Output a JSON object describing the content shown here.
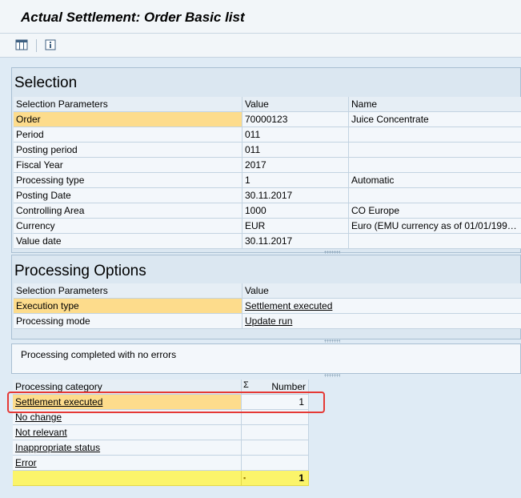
{
  "title": "Actual Settlement: Order Basic list",
  "toolbar": {
    "icons": [
      "column-layout-icon",
      "info-icon"
    ]
  },
  "selection": {
    "heading": "Selection",
    "columns": [
      "Selection Parameters",
      "Value",
      "Name"
    ],
    "rows": [
      {
        "param": "Order",
        "value": "70000123",
        "name": "Juice Concentrate"
      },
      {
        "param": "Period",
        "value": "011",
        "name": ""
      },
      {
        "param": "Posting period",
        "value": "011",
        "name": ""
      },
      {
        "param": "Fiscal Year",
        "value": "2017",
        "name": ""
      },
      {
        "param": "Processing type",
        "value": "1",
        "name": "Automatic"
      },
      {
        "param": "Posting Date",
        "value": "30.11.2017",
        "name": ""
      },
      {
        "param": "Controlling Area",
        "value": "1000",
        "name": "CO Europe"
      },
      {
        "param": "Currency",
        "value": "EUR",
        "name": "Euro (EMU currency as of 01/01/199…"
      },
      {
        "param": "Value date",
        "value": "30.11.2017",
        "name": ""
      }
    ]
  },
  "processing_options": {
    "heading": "Processing Options",
    "columns": [
      "Selection Parameters",
      "Value"
    ],
    "rows": [
      {
        "param": "Execution type",
        "value": "Settlement executed"
      },
      {
        "param": "Processing mode",
        "value": "Update run"
      }
    ]
  },
  "message": "Processing completed with no errors",
  "results": {
    "columns": {
      "category": "Processing category",
      "sigma": "Σ",
      "number": "Number"
    },
    "rows": [
      {
        "category": "Settlement executed",
        "number": "1"
      },
      {
        "category": "No change",
        "number": ""
      },
      {
        "category": "Not relevant",
        "number": ""
      },
      {
        "category": "Inappropriate status",
        "number": ""
      },
      {
        "category": "Error",
        "number": ""
      }
    ],
    "total_marker": "▪",
    "total": "1"
  },
  "colors": {
    "selected_row": "#fddc8c",
    "total_row": "#fbf46a",
    "highlight_border": "#e53935"
  }
}
